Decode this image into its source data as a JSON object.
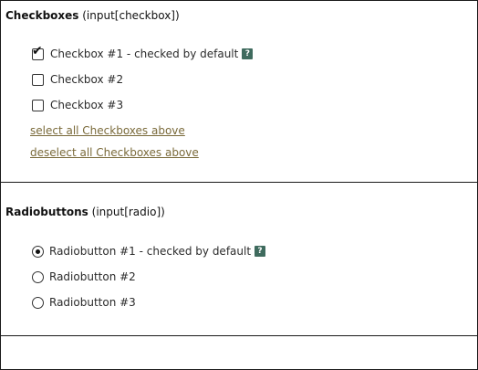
{
  "checkboxes": {
    "title_bold": "Checkboxes",
    "title_rest": " (input[checkbox])",
    "items": [
      {
        "label": "Checkbox #1 - checked by default",
        "checked": true,
        "help": "?"
      },
      {
        "label": "Checkbox #2",
        "checked": false
      },
      {
        "label": "Checkbox #3",
        "checked": false
      }
    ],
    "select_all": "select all Checkboxes above",
    "deselect_all": "deselect all Checkboxes above"
  },
  "radios": {
    "title_bold": "Radiobuttons",
    "title_rest": " (input[radio])",
    "items": [
      {
        "label": "Radiobutton #1 - checked by default",
        "checked": true,
        "help": "?"
      },
      {
        "label": "Radiobutton #2",
        "checked": false
      },
      {
        "label": "Radiobutton #3",
        "checked": false
      }
    ]
  },
  "colors": {
    "link": "#7a6a3a",
    "help_badge": "#3f6b5e",
    "border": "#1a1a1a"
  },
  "icons": {
    "check_mark": "✔",
    "help": "help-icon"
  }
}
